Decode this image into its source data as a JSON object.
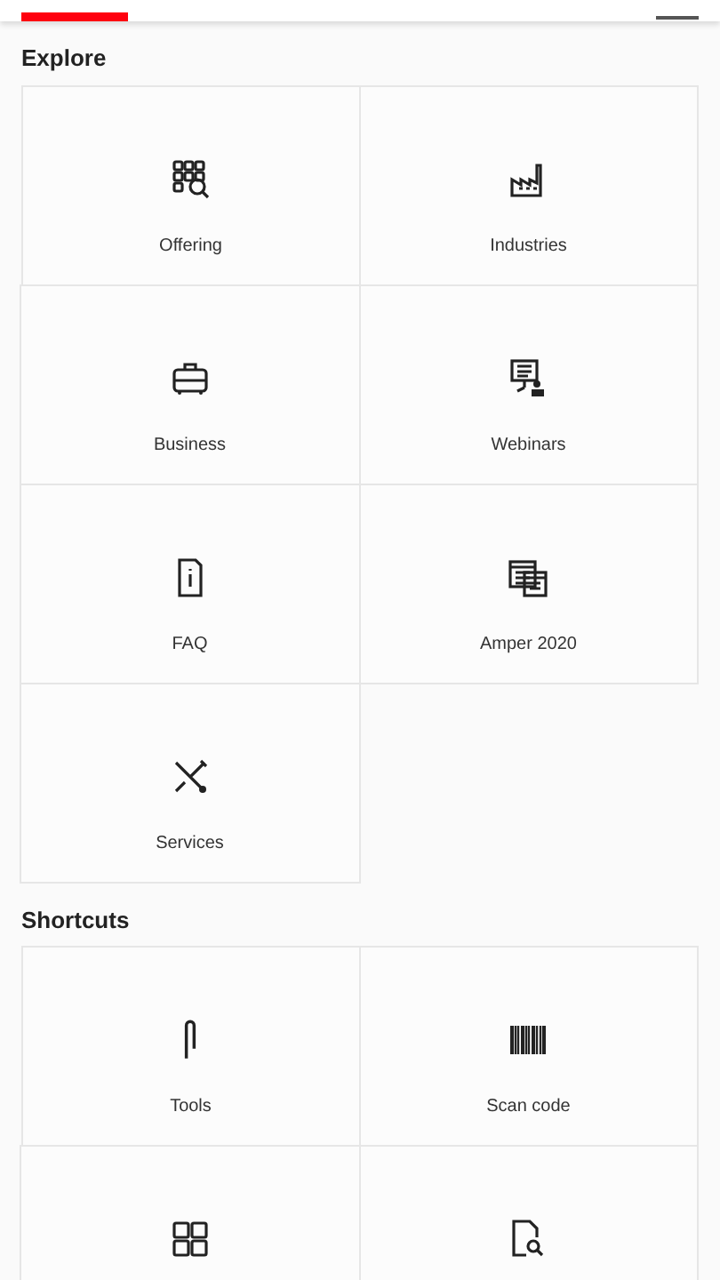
{
  "sections": [
    {
      "title": "Explore",
      "tiles": [
        {
          "kind": "labeled",
          "label": "Offering"
        },
        {
          "kind": "labeled",
          "label": "Industries"
        },
        {
          "kind": "labeled",
          "label": "Business"
        },
        {
          "kind": "labeled",
          "label": "Webinars"
        },
        {
          "kind": "labeled",
          "label": "FAQ"
        },
        {
          "kind": "labeled",
          "label": "Amper 2020"
        },
        {
          "kind": "labeled",
          "label": "Services"
        }
      ]
    },
    {
      "title": "Shortcuts",
      "tiles": [
        {
          "kind": "labeled",
          "label": "Tools"
        },
        {
          "kind": "labeled",
          "label": "Scan code"
        },
        {
          "kind": "cut"
        },
        {
          "kind": "cut"
        }
      ]
    }
  ]
}
